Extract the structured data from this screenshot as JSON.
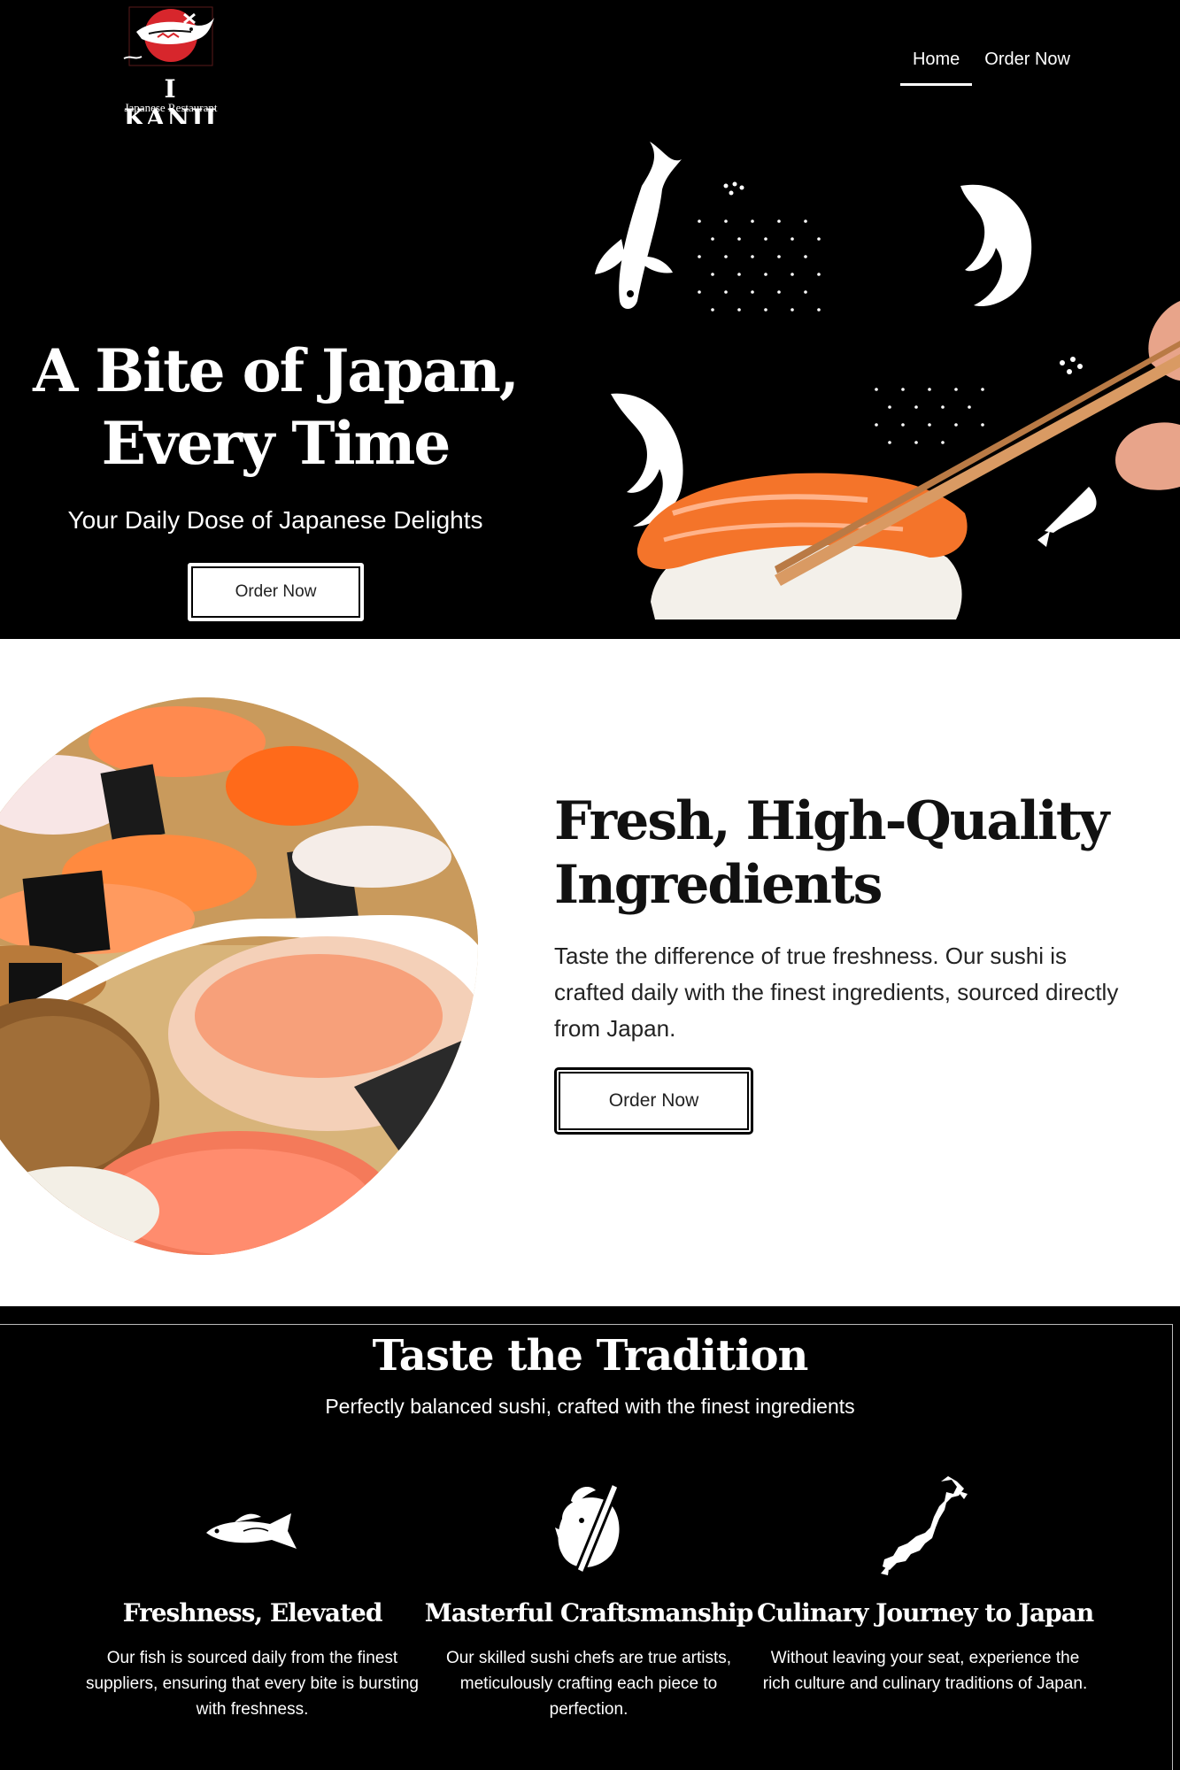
{
  "header": {
    "logo_text": "I KANJI",
    "logo_tagline": "Japanese Restaurant",
    "nav": [
      {
        "label": "Home"
      },
      {
        "label": "Order Now"
      }
    ]
  },
  "hero": {
    "title": "A Bite of Japan, Every Time",
    "subtitle": "Your Daily Dose of Japanese Delights",
    "button_label": "Order Now"
  },
  "feature": {
    "title": "Fresh, High-Quality Ingredients",
    "text": "Taste the difference of true freshness. Our sushi is crafted daily with the finest ingredients, sourced directly from Japan.",
    "button_label": "Order Now"
  },
  "tradition": {
    "title": "Taste the Tradition",
    "subtitle": "Perfectly balanced sushi, crafted with the finest ingredients",
    "cards": [
      {
        "icon": "fish-icon",
        "title": "Freshness, Elevated",
        "text": "Our fish is sourced daily from the finest suppliers, ensuring that every bite is bursting with freshness."
      },
      {
        "icon": "chef-knife-icon",
        "title": "Masterful Craftsmanship",
        "text": "Our skilled sushi chefs are true artists, meticulously crafting each piece to perfection."
      },
      {
        "icon": "japan-map-icon",
        "title": "Culinary Journey to Japan",
        "text": "Without leaving your seat, experience the rich culture and culinary traditions of Japan."
      }
    ]
  },
  "colors": {
    "background_dark": "#000000",
    "background_light": "#ffffff",
    "logo_red": "#d7262c",
    "salmon": "#f4742a"
  }
}
